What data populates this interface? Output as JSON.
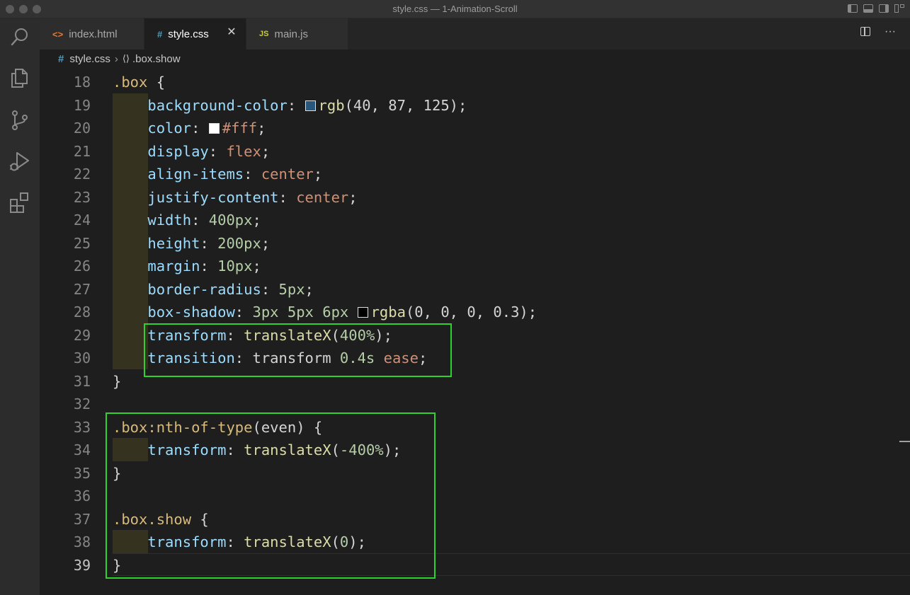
{
  "window": {
    "title": "style.css — 1-Animation-Scroll"
  },
  "tabs": [
    {
      "label": "index.html",
      "icon": "<>",
      "active": false
    },
    {
      "label": "style.css",
      "icon": "#",
      "active": true
    },
    {
      "label": "main.js",
      "icon": "JS",
      "active": false
    }
  ],
  "editor_actions": {
    "more": "···"
  },
  "breadcrumb": {
    "file": "style.css",
    "symbol": ".box.show"
  },
  "colors": {
    "highlight_box": "#2ed12e",
    "swatch_bg": "#28577d",
    "swatch_fg": "#ffffff",
    "swatch_shadow": "#000000"
  },
  "line_numbers": [
    "18",
    "19",
    "20",
    "21",
    "22",
    "23",
    "24",
    "25",
    "26",
    "27",
    "28",
    "29",
    "30",
    "31",
    "32",
    "33",
    "34",
    "35",
    "36",
    "37",
    "38",
    "39"
  ],
  "code": {
    "l18": {
      "sel": ".box",
      "brace": " {"
    },
    "l19": {
      "prop": "background-color",
      "colon": ": ",
      "fn": "rgb",
      "args": "(40, 87, 125);"
    },
    "l20": {
      "prop": "color",
      "colon": ": ",
      "val": "#fff",
      "semi": ";"
    },
    "l21": {
      "prop": "display",
      "colon": ": ",
      "val": "flex",
      "semi": ";"
    },
    "l22": {
      "prop": "align-items",
      "colon": ": ",
      "val": "center",
      "semi": ";"
    },
    "l23": {
      "prop": "justify-content",
      "colon": ": ",
      "val": "center",
      "semi": ";"
    },
    "l24": {
      "prop": "width",
      "colon": ": ",
      "num": "400px",
      "semi": ";"
    },
    "l25": {
      "prop": "height",
      "colon": ": ",
      "num": "200px",
      "semi": ";"
    },
    "l26": {
      "prop": "margin",
      "colon": ": ",
      "num": "10px",
      "semi": ";"
    },
    "l27": {
      "prop": "border-radius",
      "colon": ": ",
      "num": "5px",
      "semi": ";"
    },
    "l28": {
      "prop": "box-shadow",
      "colon": ": ",
      "nums": "3px 5px 6px ",
      "fn": "rgba",
      "args": "(0, 0, 0, 0.3);"
    },
    "l29": {
      "prop": "transform",
      "colon": ": ",
      "fn": "translateX",
      "open": "(",
      "num": "400%",
      "close": ");"
    },
    "l30": {
      "prop": "transition",
      "colon": ": ",
      "plain": "transform ",
      "num": "0.4s",
      "sp": " ",
      "val": "ease",
      "semi": ";"
    },
    "l31": {
      "brace": "}"
    },
    "l33": {
      "sel": ".box:nth-of-type",
      "plain": "(even)",
      "brace": " {"
    },
    "l34": {
      "prop": "transform",
      "colon": ": ",
      "fn": "translateX",
      "open": "(",
      "num": "-400%",
      "close": ");"
    },
    "l35": {
      "brace": "}"
    },
    "l37": {
      "sel": ".box.show",
      "brace": " {"
    },
    "l38": {
      "prop": "transform",
      "colon": ": ",
      "fn": "translateX",
      "open": "(",
      "num": "0",
      "close": ");"
    },
    "l39": {
      "brace": "}"
    }
  }
}
